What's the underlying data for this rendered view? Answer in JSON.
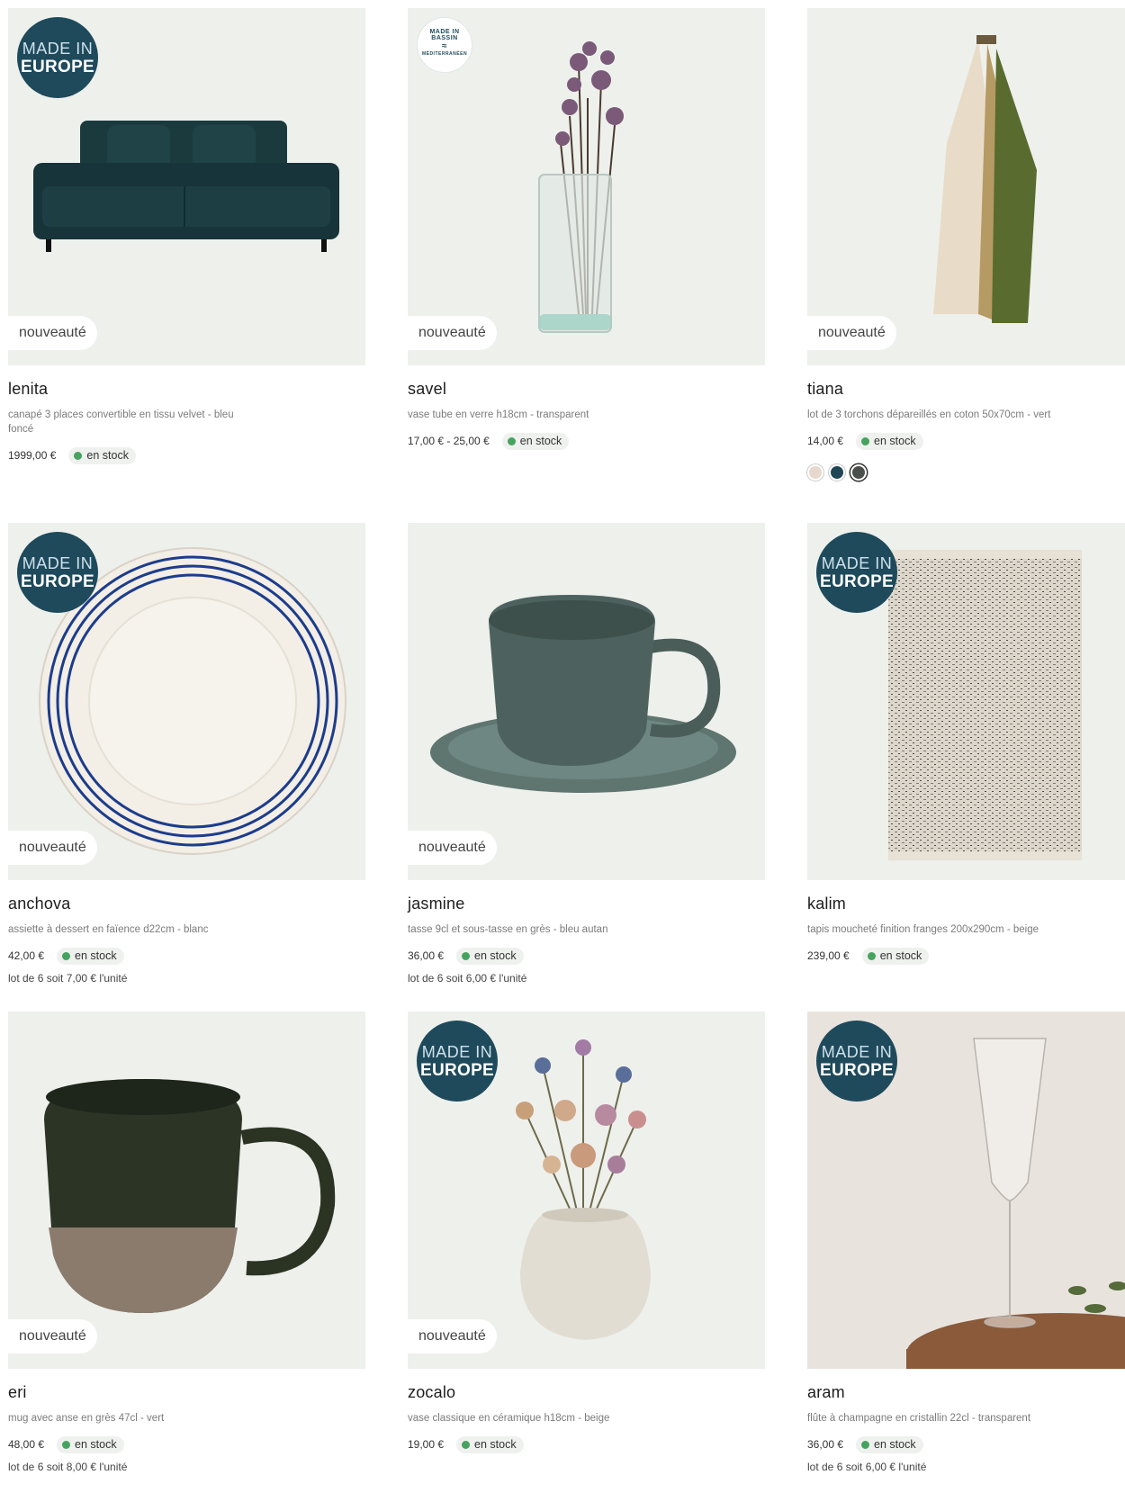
{
  "products": [
    {
      "name": "lenita",
      "desc": "canapé 3 places convertible en tissu velvet - bleu foncé",
      "price": "1999,00 €",
      "stock": "en stock",
      "badge_line1": "MADE IN",
      "badge_line2": "EUROPE",
      "tag": "nouveauté"
    },
    {
      "name": "savel",
      "desc": "vase tube en verre h18cm - transparent",
      "price": "17,00 € - 25,00 €",
      "stock": "en stock",
      "badge_bassin": [
        "MADE IN",
        "BASSIN",
        "MÉDITERRANÉEN"
      ],
      "tag": "nouveauté"
    },
    {
      "name": "tiana",
      "desc": "lot de 3 torchons dépareillés en coton 50x70cm - vert",
      "price": "14,00 €",
      "stock": "en stock",
      "tag": "nouveauté",
      "swatches": [
        {
          "color": "#e6d8cc"
        },
        {
          "color": "#1f4556"
        },
        {
          "color": "#4a4f4c"
        }
      ]
    },
    {
      "name": "anchova",
      "desc": "assiette à dessert en faïence d22cm - blanc",
      "price": "42,00 €",
      "stock": "en stock",
      "lot": "lot de 6 soit 7,00 € l'unité",
      "badge_line1": "MADE IN",
      "badge_line2": "EUROPE",
      "tag": "nouveauté"
    },
    {
      "name": "jasmine",
      "desc": "tasse 9cl et sous-tasse en grès - bleu autan",
      "price": "36,00 €",
      "stock": "en stock",
      "lot": "lot de 6 soit 6,00 € l'unité",
      "tag": "nouveauté"
    },
    {
      "name": "kalim",
      "desc": "tapis moucheté finition franges 200x290cm - beige",
      "price": "239,00 €",
      "stock": "en stock",
      "badge_line1": "MADE IN",
      "badge_line2": "EUROPE"
    },
    {
      "name": "eri",
      "desc": "mug avec anse en grès 47cl - vert",
      "price": "48,00 €",
      "stock": "en stock",
      "lot": "lot de 6 soit 8,00 € l'unité",
      "tag": "nouveauté"
    },
    {
      "name": "zocalo",
      "desc": "vase classique en céramique h18cm - beige",
      "price": "19,00 €",
      "stock": "en stock",
      "badge_line1": "MADE IN",
      "badge_line2": "EUROPE",
      "tag": "nouveauté"
    },
    {
      "name": "aram",
      "desc": "flûte à champagne en cristallin 22cl - transparent",
      "price": "36,00 €",
      "stock": "en stock",
      "lot": "lot de 6 soit 6,00 € l'unité",
      "badge_line1": "MADE IN",
      "badge_line2": "EUROPE"
    }
  ],
  "colors": {
    "badge_blue": "#1e4a5c",
    "stock_green": "#46a35e",
    "media_bg": "#eef0ec"
  }
}
